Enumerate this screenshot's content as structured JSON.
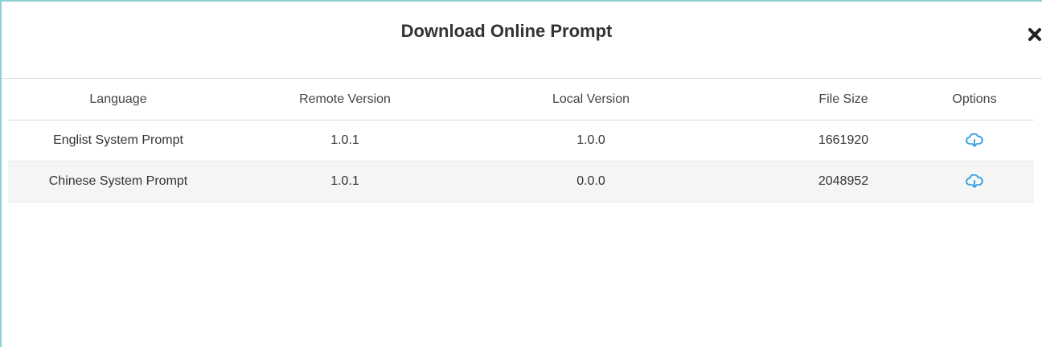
{
  "dialog": {
    "title": "Download Online Prompt",
    "close_icon": "close-icon"
  },
  "table": {
    "columns": [
      "Language",
      "Remote Version",
      "Local Version",
      "File Size",
      "Options"
    ],
    "rows": [
      {
        "language": "Englist System Prompt",
        "remote_version": "1.0.1",
        "local_version": "1.0.0",
        "file_size": "1661920",
        "option_icon": "cloud-download-icon"
      },
      {
        "language": "Chinese System Prompt",
        "remote_version": "1.0.1",
        "local_version": "0.0.0",
        "file_size": "2048952",
        "option_icon": "cloud-download-icon"
      }
    ]
  },
  "colors": {
    "border_accent": "#8ecfd2",
    "icon_blue": "#3ea2e0",
    "striped_row": "#f5f5f5",
    "text": "#333333"
  }
}
